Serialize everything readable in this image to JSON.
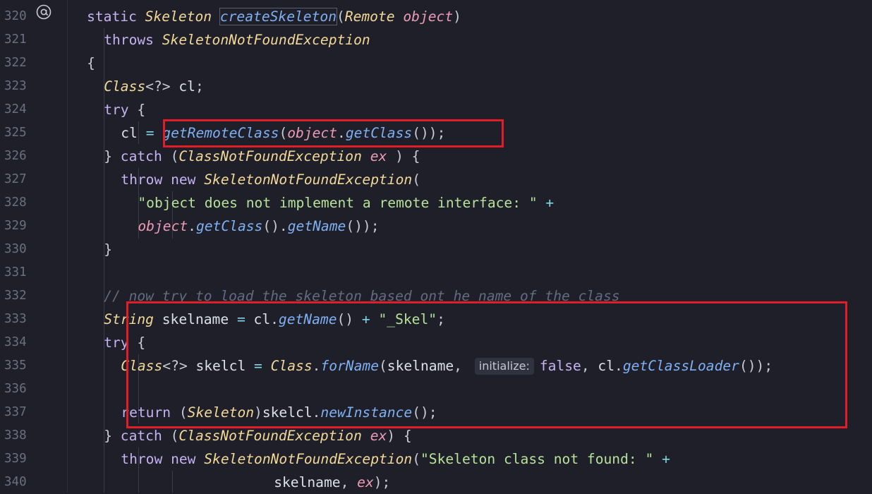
{
  "editor": {
    "lines": [
      {
        "num": "320",
        "indent": 2,
        "tokens": [
          [
            "kw",
            "static "
          ],
          [
            "cls",
            "Skeleton "
          ],
          [
            "fn",
            "createSkeleton"
          ],
          [
            "pun",
            "("
          ],
          [
            "cls",
            "Remote "
          ],
          [
            "var",
            "object"
          ],
          [
            "pun",
            ")"
          ]
        ]
      },
      {
        "num": "321",
        "indent": 4,
        "tokens": [
          [
            "kw",
            "throws "
          ],
          [
            "cls",
            "SkeletonNotFoundException"
          ]
        ]
      },
      {
        "num": "322",
        "indent": 2,
        "tokens": [
          [
            "pun",
            "{"
          ]
        ]
      },
      {
        "num": "323",
        "indent": 4,
        "tokens": [
          [
            "cls",
            "Class"
          ],
          [
            "pun",
            "<?> "
          ],
          [
            "plain",
            "cl"
          ],
          [
            "pun",
            ";"
          ]
        ]
      },
      {
        "num": "324",
        "indent": 4,
        "tokens": [
          [
            "kw",
            "try "
          ],
          [
            "pun",
            "{"
          ]
        ]
      },
      {
        "num": "325",
        "indent": 6,
        "tokens": [
          [
            "plain",
            "cl "
          ],
          [
            "op",
            "= "
          ],
          [
            "fn",
            "getRemoteClass"
          ],
          [
            "pun",
            "("
          ],
          [
            "var",
            "object"
          ],
          [
            "pun",
            "."
          ],
          [
            "fn",
            "getClass"
          ],
          [
            "pun",
            "());"
          ]
        ]
      },
      {
        "num": "326",
        "indent": 4,
        "tokens": [
          [
            "pun",
            "} "
          ],
          [
            "kw",
            "catch "
          ],
          [
            "pun",
            "("
          ],
          [
            "cls",
            "ClassNotFoundException "
          ],
          [
            "var",
            "ex"
          ],
          [
            "pun",
            " ) {"
          ]
        ]
      },
      {
        "num": "327",
        "indent": 6,
        "tokens": [
          [
            "kw",
            "throw new "
          ],
          [
            "cls",
            "SkeletonNotFoundException"
          ],
          [
            "pun",
            "("
          ]
        ]
      },
      {
        "num": "328",
        "indent": 8,
        "tokens": [
          [
            "str",
            "\"object does not implement a remote interface: \" "
          ],
          [
            "op",
            "+"
          ]
        ]
      },
      {
        "num": "329",
        "indent": 8,
        "tokens": [
          [
            "var",
            "object"
          ],
          [
            "pun",
            "."
          ],
          [
            "fn",
            "getClass"
          ],
          [
            "pun",
            "()."
          ],
          [
            "fn",
            "getName"
          ],
          [
            "pun",
            "());"
          ]
        ]
      },
      {
        "num": "330",
        "indent": 4,
        "tokens": [
          [
            "pun",
            "}"
          ]
        ]
      },
      {
        "num": "331",
        "indent": 0,
        "tokens": []
      },
      {
        "num": "332",
        "indent": 4,
        "tokens": [
          [
            "cmt",
            "// now try to load the skeleton based ont he name of the class"
          ]
        ]
      },
      {
        "num": "333",
        "indent": 4,
        "tokens": [
          [
            "cls",
            "String "
          ],
          [
            "plain",
            "skelname "
          ],
          [
            "op",
            "= "
          ],
          [
            "plain",
            "cl"
          ],
          [
            "pun",
            "."
          ],
          [
            "fn",
            "getName"
          ],
          [
            "pun",
            "() "
          ],
          [
            "op",
            "+ "
          ],
          [
            "str",
            "\"_Skel\""
          ],
          [
            "pun",
            ";"
          ]
        ]
      },
      {
        "num": "334",
        "indent": 4,
        "tokens": [
          [
            "kw",
            "try "
          ],
          [
            "pun",
            "{"
          ]
        ]
      },
      {
        "num": "335",
        "indent": 6,
        "tokens": [
          [
            "cls",
            "Class"
          ],
          [
            "pun",
            "<?> "
          ],
          [
            "plain",
            "skelcl "
          ],
          [
            "op",
            "= "
          ],
          [
            "cls",
            "Class"
          ],
          [
            "pun",
            "."
          ],
          [
            "fn",
            "forName"
          ],
          [
            "pun",
            "("
          ],
          [
            "plain",
            "skelname"
          ],
          [
            "pun",
            ", "
          ],
          [
            "hint",
            "initialize:"
          ],
          [
            "kw",
            "false"
          ],
          [
            "pun",
            ", "
          ],
          [
            "plain",
            "cl"
          ],
          [
            "pun",
            "."
          ],
          [
            "fn",
            "getClassLoader"
          ],
          [
            "pun",
            "());"
          ]
        ]
      },
      {
        "num": "336",
        "indent": 0,
        "tokens": []
      },
      {
        "num": "337",
        "indent": 6,
        "tokens": [
          [
            "kw",
            "return "
          ],
          [
            "pun",
            "("
          ],
          [
            "cls",
            "Skeleton"
          ],
          [
            "pun",
            ")"
          ],
          [
            "plain",
            "skelcl"
          ],
          [
            "pun",
            "."
          ],
          [
            "fn",
            "newInstance"
          ],
          [
            "pun",
            "();"
          ]
        ]
      },
      {
        "num": "338",
        "indent": 4,
        "tokens": [
          [
            "pun",
            "} "
          ],
          [
            "kw",
            "catch "
          ],
          [
            "pun",
            "("
          ],
          [
            "cls",
            "ClassNotFoundException "
          ],
          [
            "var",
            "ex"
          ],
          [
            "pun",
            ") {"
          ]
        ]
      },
      {
        "num": "339",
        "indent": 6,
        "tokens": [
          [
            "kw",
            "throw new "
          ],
          [
            "cls",
            "SkeletonNotFoundException"
          ],
          [
            "pun",
            "("
          ],
          [
            "str",
            "\"Skeleton class not found: \" "
          ],
          [
            "op",
            "+"
          ]
        ]
      },
      {
        "num": "340",
        "indent": 24,
        "tokens": [
          [
            "plain",
            "skelname"
          ],
          [
            "pun",
            ", "
          ],
          [
            "var",
            "ex"
          ],
          [
            "pun",
            ");"
          ]
        ]
      }
    ],
    "gutter_icon": "at-sign-icon",
    "highlight_color": "#e01e28"
  }
}
